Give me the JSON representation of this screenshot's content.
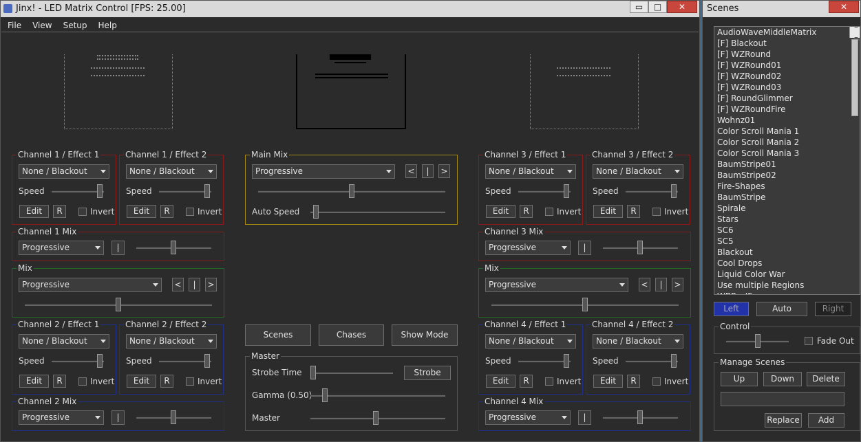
{
  "main_window": {
    "title": "Jinx! - LED Matrix Control [FPS: 25.00]",
    "buttons": {
      "minimize": "▭",
      "maximize": "□",
      "close": "✕"
    }
  },
  "menu": [
    "File",
    "View",
    "Setup",
    "Help"
  ],
  "ch1": {
    "fx1": {
      "legend": "Channel 1 / Effect 1",
      "effect": "None / Blackout",
      "speed": "Speed",
      "edit": "Edit",
      "r": "R",
      "invert": "Invert"
    },
    "fx2": {
      "legend": "Channel 1 / Effect 2",
      "effect": "None / Blackout",
      "speed": "Speed",
      "edit": "Edit",
      "r": "R",
      "invert": "Invert"
    },
    "mix": {
      "legend": "Channel 1 Mix",
      "mode": "Progressive",
      "pipe": "|"
    }
  },
  "ch2": {
    "fx1": {
      "legend": "Channel 2 / Effect 1",
      "effect": "None / Blackout",
      "speed": "Speed",
      "edit": "Edit",
      "r": "R",
      "invert": "Invert"
    },
    "fx2": {
      "legend": "Channel 2 / Effect 2",
      "effect": "None / Blackout",
      "speed": "Speed",
      "edit": "Edit",
      "r": "R",
      "invert": "Invert"
    },
    "mix": {
      "legend": "Channel 2 Mix",
      "mode": "Progressive",
      "pipe": "|"
    }
  },
  "ch3": {
    "fx1": {
      "legend": "Channel 3 / Effect 1",
      "effect": "None / Blackout",
      "speed": "Speed",
      "edit": "Edit",
      "r": "R",
      "invert": "Invert"
    },
    "fx2": {
      "legend": "Channel 3 / Effect 2",
      "effect": "None / Blackout",
      "speed": "Speed",
      "edit": "Edit",
      "r": "R",
      "invert": "Invert"
    },
    "mix": {
      "legend": "Channel 3 Mix",
      "mode": "Progressive",
      "pipe": "|"
    }
  },
  "ch4": {
    "fx1": {
      "legend": "Channel 4 / Effect 1",
      "effect": "None / Blackout",
      "speed": "Speed",
      "edit": "Edit",
      "r": "R",
      "invert": "Invert"
    },
    "fx2": {
      "legend": "Channel 4 / Effect 2",
      "effect": "None / Blackout",
      "speed": "Speed",
      "edit": "Edit",
      "r": "R",
      "invert": "Invert"
    },
    "mix": {
      "legend": "Channel 4 Mix",
      "mode": "Progressive",
      "pipe": "|"
    }
  },
  "mix_left": {
    "legend": "Mix",
    "mode": "Progressive",
    "prev": "<",
    "pipe": "|",
    "next": ">"
  },
  "mix_right": {
    "legend": "Mix",
    "mode": "Progressive",
    "prev": "<",
    "pipe": "|",
    "next": ">"
  },
  "main_mix": {
    "legend": "Main Mix",
    "mode": "Progressive",
    "prev": "<",
    "pipe": "|",
    "next": ">",
    "auto_speed": "Auto Speed"
  },
  "center_buttons": {
    "scenes": "Scenes",
    "chases": "Chases",
    "show_mode": "Show Mode"
  },
  "master": {
    "legend": "Master",
    "strobe_time": "Strobe Time",
    "strobe": "Strobe",
    "gamma": "Gamma (0.50)",
    "master": "Master"
  },
  "scenes_window": {
    "title": "Scenes",
    "close": "✕",
    "items": [
      "AudioWaveMiddleMatrix",
      "[F] Blackout",
      "[F] WZRound",
      "[F] WZRound01",
      "[F] WZRound02",
      "[F] WZRound03",
      "[F] RoundGlimmer",
      "[F] WZRoundFire",
      "Wohnz01",
      "Color Scroll Mania 1",
      "Color Scroll Mania 2",
      "Color Scroll Mania 3",
      "BaumStripe01",
      "BaumStripe02",
      "Fire-Shapes",
      "BaumStripe",
      "Spirale",
      "Stars",
      "SC6",
      "SC5",
      "Blackout",
      "Cool Drops",
      "Liquid Color War",
      "Use multiple Regions",
      "WBP... IF..."
    ],
    "left": "Left",
    "auto": "Auto",
    "right": "Right",
    "control": {
      "legend": "Control",
      "fade_out": "Fade Out"
    },
    "manage": {
      "legend": "Manage Scenes",
      "up": "Up",
      "down": "Down",
      "delete": "Delete",
      "name_value": "",
      "replace": "Replace",
      "add": "Add"
    }
  },
  "colors": {
    "accent_left": "#2233aa",
    "channel_red": "#8b1a1a",
    "mix_green": "#1f6b1f",
    "channel_blue": "#1f2f8b",
    "main_mix_yellow": "#a38a12"
  }
}
